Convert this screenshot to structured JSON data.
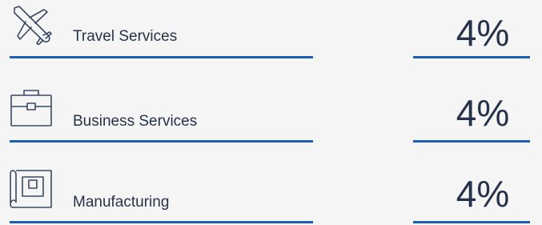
{
  "colors": {
    "background": "#f5f5f5",
    "accent_line": "#1b5eb4",
    "text": "#263347",
    "icon_stroke": "#3a4a63"
  },
  "rows": [
    {
      "icon": "airplane-icon",
      "label": "Travel Services",
      "value": "4%"
    },
    {
      "icon": "briefcase-icon",
      "label": "Business Services",
      "value": "4%"
    },
    {
      "icon": "blueprint-icon",
      "label": "Manufacturing",
      "value": "4%"
    }
  ]
}
